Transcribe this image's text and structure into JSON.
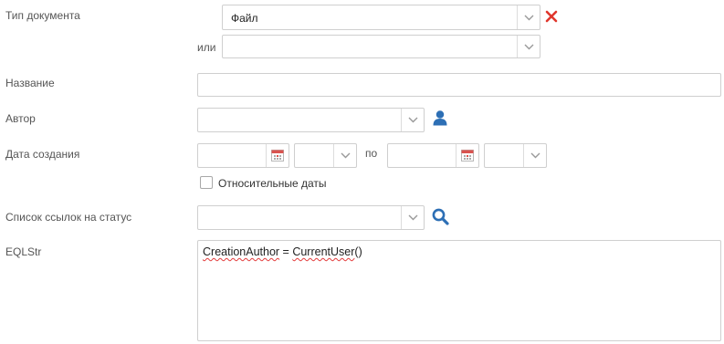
{
  "form": {
    "doc_type": {
      "label": "Тип документа",
      "value": "Файл",
      "or_label": "или",
      "second_value": ""
    },
    "name": {
      "label": "Название",
      "value": ""
    },
    "author": {
      "label": "Автор",
      "value": ""
    },
    "created": {
      "label": "Дата создания",
      "from_date": "",
      "from_time": "",
      "to_label": "по",
      "to_date": "",
      "to_time": "",
      "relative_label": "Относительные даты",
      "relative_checked": false
    },
    "status_links": {
      "label": "Список ссылок на статус",
      "value": ""
    },
    "eqlstr": {
      "label": "EQLStr",
      "token1": "CreationAuthor",
      "operator": " = ",
      "token2": "CurrentUser",
      "parens": "()"
    }
  },
  "colors": {
    "remove_icon": "#e0362c",
    "accent_icon": "#2d6fb5",
    "calendar_icon": "#d9534f",
    "border": "#cfcfcf"
  },
  "icons": [
    "chevron-down-icon",
    "remove-icon",
    "user-icon",
    "calendar-icon",
    "search-icon"
  ]
}
